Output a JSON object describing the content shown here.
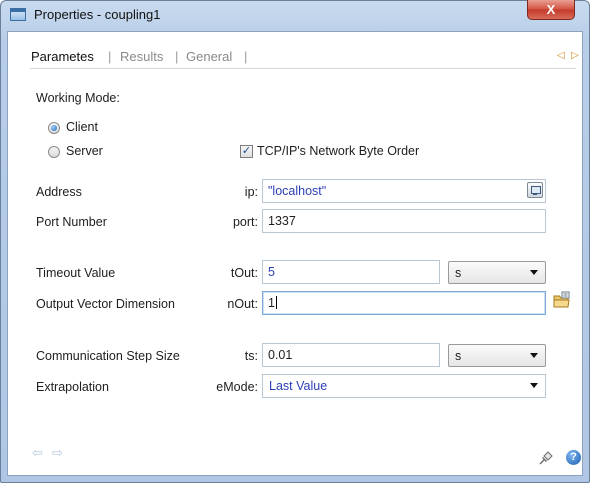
{
  "window": {
    "title": "Properties - coupling1",
    "close_glyph": "X"
  },
  "tabs": [
    {
      "label": "Parametes",
      "active": true
    },
    {
      "label": "Results",
      "active": false
    },
    {
      "label": "General",
      "active": false
    }
  ],
  "tab_separator": "|",
  "tab_nav": {
    "prev_glyph": "◁",
    "next_glyph": "▷"
  },
  "working_mode": {
    "label": "Working Mode:",
    "options": [
      {
        "label": "Client",
        "selected": true
      },
      {
        "label": "Server",
        "selected": false
      }
    ]
  },
  "byte_order": {
    "label": "TCP/IP's Network Byte Order",
    "checked": true,
    "check_glyph": "✓"
  },
  "params": {
    "address": {
      "label": "Address",
      "var": "ip:",
      "value": "\"localhost\""
    },
    "port": {
      "label": "Port Number",
      "var": "port:",
      "value": "1337"
    },
    "timeout": {
      "label": "Timeout Value",
      "var": "tOut:",
      "value": "5",
      "unit": "s"
    },
    "output_dim": {
      "label": "Output Vector Dimension",
      "var": "nOut:",
      "value": "1"
    },
    "comm_step": {
      "label": "Communication Step Size",
      "var": "ts:",
      "value": "0.01",
      "unit": "s"
    },
    "extrapolation": {
      "label": "Extrapolation",
      "var": "eMode:",
      "value": "Last Value"
    }
  },
  "footer": {
    "back_glyph": "⇦",
    "forward_glyph": "⇨",
    "help_glyph": "?"
  },
  "icons": {
    "window": "window-icon",
    "address_picker": "computer-icon",
    "output_dim": "folder-icon",
    "pin": "pin-icon",
    "help": "help-icon"
  }
}
